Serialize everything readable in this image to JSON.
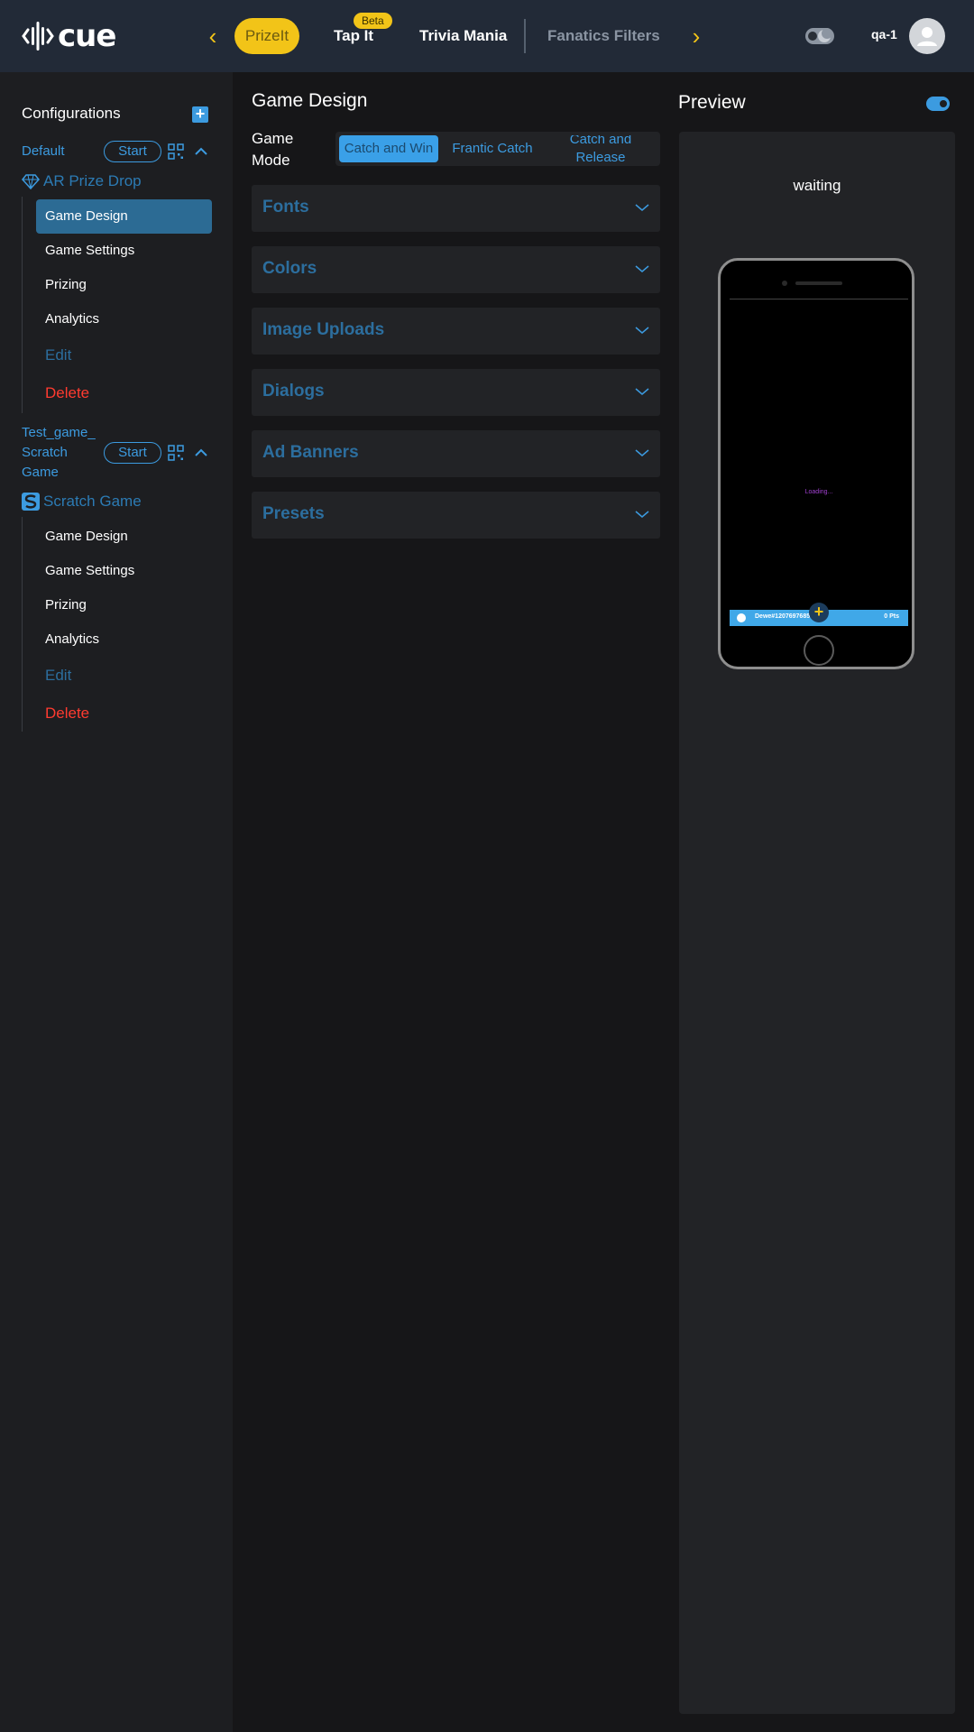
{
  "header": {
    "logo_text": "cue",
    "tabs": [
      {
        "label": "PrizeIt"
      },
      {
        "label": "Tap It",
        "badge": "Beta"
      },
      {
        "label": "Trivia Mania"
      },
      {
        "label": "Fanatics Filters"
      }
    ],
    "username": "qa-1"
  },
  "sidebar": {
    "title": "Configurations",
    "configs": [
      {
        "name": "Default",
        "start_label": "Start",
        "game_type": "AR Prize Drop",
        "items": [
          "Game Design",
          "Game Settings",
          "Prizing",
          "Analytics",
          "Edit",
          "Delete"
        ],
        "active_item": "Game Design"
      },
      {
        "name_lines": [
          "Test_game_",
          "Scratch",
          "Game"
        ],
        "start_label": "Start",
        "game_type": "Scratch Game",
        "items": [
          "Game Design",
          "Game Settings",
          "Prizing",
          "Analytics",
          "Edit",
          "Delete"
        ]
      }
    ]
  },
  "main": {
    "title": "Game Design",
    "game_mode_label": "Game Mode",
    "game_modes": [
      {
        "label": "Catch and Win",
        "selected": true
      },
      {
        "label": "Frantic Catch",
        "selected": false
      },
      {
        "label": "Catch and Release",
        "selected": false
      }
    ],
    "sections": [
      "Fonts",
      "Colors",
      "Image Uploads",
      "Dialogs",
      "Ad Banners",
      "Presets"
    ]
  },
  "preview": {
    "title": "Preview",
    "status": "waiting",
    "phone": {
      "loading_text": "Loading...",
      "user_text": "Dewe#1207697685",
      "points_text": "0 Pts"
    }
  },
  "colors": {
    "accent": "#3c9be0",
    "brand_yellow": "#f2c418",
    "delete_red": "#ff3b30",
    "active_item_bg": "#2c6b94"
  }
}
